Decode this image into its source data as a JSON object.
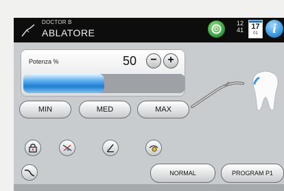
{
  "header": {
    "device_label": "DOCTOR B",
    "mode_title": "ABLATORE",
    "time_hours": "12",
    "time_minutes": "41",
    "date_day": "17",
    "date_month": "01",
    "info_symbol": "i"
  },
  "power": {
    "label": "Potenza  %",
    "value": "50",
    "level_percent": 50,
    "minus_symbol": "−",
    "plus_symbol": "+"
  },
  "presets": {
    "min_label": "MIN",
    "med_label": "MED",
    "max_label": "MAX"
  },
  "tool_icons": [
    "lock-icon",
    "water-off-icon",
    "irrigation-icon",
    "light-icon",
    "handpiece-tip-icon"
  ],
  "footer": {
    "normal_label": "NORMAL",
    "program_label": "PROGRAM P1"
  },
  "colors": {
    "topbar": "#0d0d0d",
    "status_green": "#3aa845",
    "accent_blue": "#2d8fd6",
    "panel_gray": "#c9cccf"
  }
}
